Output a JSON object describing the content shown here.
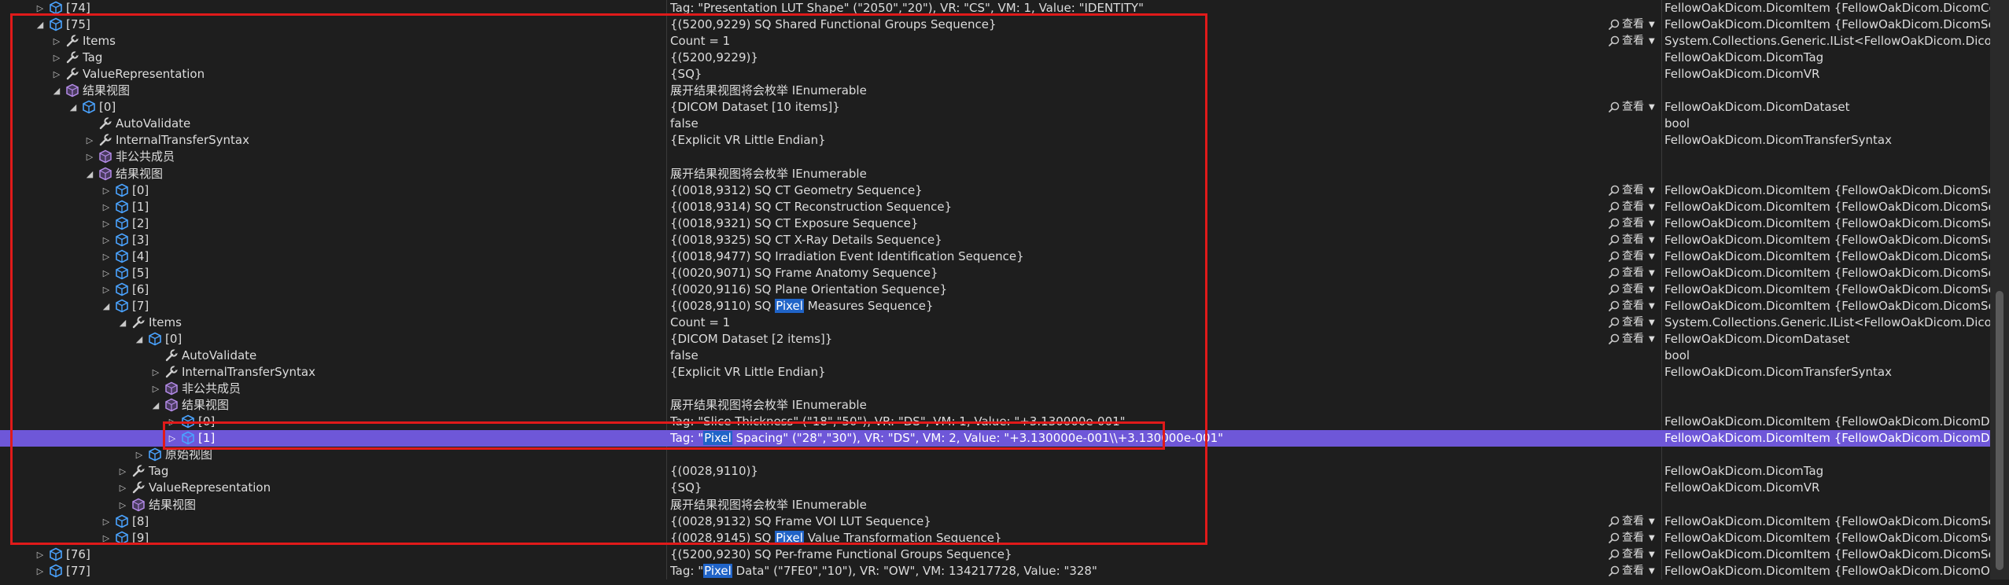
{
  "viewer_label": "查看",
  "colors": {
    "background": "#1e1e1e",
    "selected_row": "#6e57d8",
    "search_highlight": "#2064c8",
    "annotation_red": "#e01a1a",
    "cube_icon": "#4aa3ff",
    "struct_icon": "#9b6fd6"
  },
  "rows": [
    {
      "name": "[74]",
      "value": "Tag: \"Presentation LUT Shape\" (\"2050\",\"20\"), VR: \"CS\", VM: 1, Value: \"IDENTITY\"",
      "type": "FellowOakDicom.DicomItem {FellowOakDicom.DicomCodeSt…",
      "icon": "cube-icon"
    },
    {
      "name": "[75]",
      "value": "{(5200,9229) SQ Shared Functional Groups Sequence}",
      "type": "FellowOakDicom.DicomItem {FellowOakDicom.DicomSeque…",
      "icon": "cube-icon"
    },
    {
      "name": "Items",
      "value": "Count = 1",
      "type": "System.Collections.Generic.IList<FellowOakDicom.DicomData…",
      "icon": "wrench-icon"
    },
    {
      "name": "Tag",
      "value": "{(5200,9229)}",
      "type": "FellowOakDicom.DicomTag",
      "icon": "wrench-icon"
    },
    {
      "name": "ValueRepresentation",
      "value": "{SQ}",
      "type": "FellowOakDicom.DicomVR",
      "icon": "wrench-icon"
    },
    {
      "name": "结果视图",
      "value": "展开结果视图将会枚举 IEnumerable",
      "type": "",
      "icon": "struct-icon"
    },
    {
      "name": "[0]",
      "value": "{DICOM Dataset [10 items]}",
      "type": "FellowOakDicom.DicomDataset",
      "icon": "cube-icon"
    },
    {
      "name": "AutoValidate",
      "value": "false",
      "type": "bool",
      "icon": "wrench-icon"
    },
    {
      "name": "InternalTransferSyntax",
      "value": "{Explicit VR Little Endian}",
      "type": "FellowOakDicom.DicomTransferSyntax",
      "icon": "wrench-icon"
    },
    {
      "name": "非公共成员",
      "value": "",
      "type": "",
      "icon": "struct-icon"
    },
    {
      "name": "结果视图",
      "value": "展开结果视图将会枚举 IEnumerable",
      "type": "",
      "icon": "struct-icon"
    },
    {
      "name": "[0]",
      "value": "{(0018,9312) SQ CT Geometry Sequence}",
      "type": "FellowOakDicom.DicomItem {FellowOakDicom.DicomSeque…",
      "icon": "cube-icon"
    },
    {
      "name": "[1]",
      "value": "{(0018,9314) SQ CT Reconstruction Sequence}",
      "type": "FellowOakDicom.DicomItem {FellowOakDicom.DicomSeque…",
      "icon": "cube-icon"
    },
    {
      "name": "[2]",
      "value": "{(0018,9321) SQ CT Exposure Sequence}",
      "type": "FellowOakDicom.DicomItem {FellowOakDicom.DicomSeque…",
      "icon": "cube-icon"
    },
    {
      "name": "[3]",
      "value": "{(0018,9325) SQ CT X-Ray Details Sequence}",
      "type": "FellowOakDicom.DicomItem {FellowOakDicom.DicomSeque…",
      "icon": "cube-icon"
    },
    {
      "name": "[4]",
      "value": "{(0018,9477) SQ Irradiation Event Identification Sequence}",
      "type": "FellowOakDicom.DicomItem {FellowOakDicom.DicomSeque…",
      "icon": "cube-icon"
    },
    {
      "name": "[5]",
      "value": "{(0020,9071) SQ Frame Anatomy Sequence}",
      "type": "FellowOakDicom.DicomItem {FellowOakDicom.DicomSeque…",
      "icon": "cube-icon"
    },
    {
      "name": "[6]",
      "value": "{(0020,9116) SQ Plane Orientation Sequence}",
      "type": "FellowOakDicom.DicomItem {FellowOakDicom.DicomSeque…",
      "icon": "cube-icon"
    },
    {
      "name": "[7]",
      "value_pre": "{(0028,9110) SQ ",
      "value_hl": "Pixel",
      "value_post": " Measures Sequence}",
      "type": "FellowOakDicom.DicomItem {FellowOakDicom.DicomSeque…",
      "icon": "cube-icon"
    },
    {
      "name": "Items",
      "value": "Count = 1",
      "type": "System.Collections.Generic.IList<FellowOakDicom.DicomData…",
      "icon": "wrench-icon"
    },
    {
      "name": "[0]",
      "value": "{DICOM Dataset [2 items]}",
      "type": "FellowOakDicom.DicomDataset",
      "icon": "cube-icon"
    },
    {
      "name": "AutoValidate",
      "value": "false",
      "type": "bool",
      "icon": "wrench-icon"
    },
    {
      "name": "InternalTransferSyntax",
      "value": "{Explicit VR Little Endian}",
      "type": "FellowOakDicom.DicomTransferSyntax",
      "icon": "wrench-icon"
    },
    {
      "name": "非公共成员",
      "value": "",
      "type": "",
      "icon": "struct-icon"
    },
    {
      "name": "结果视图",
      "value": "展开结果视图将会枚举 IEnumerable",
      "type": "",
      "icon": "struct-icon"
    },
    {
      "name": "[0]",
      "value": "Tag: \"Slice Thickness\" (\"18\",\"50\"), VR: \"DS\", VM: 1, Value: \"+3.130000e-001\"",
      "type": "FellowOakDicom.DicomItem {FellowOakDicom.DicomDecim…",
      "icon": "cube-icon"
    },
    {
      "name": "[1]",
      "value_pre": "Tag: \"",
      "value_hl": "Pixel",
      "value_post": " Spacing\" (\"28\",\"30\"), VR: \"DS\", VM: 2, Value: \"+3.130000e-001\\\\+3.130000e-001\"",
      "type": "FellowOakDicom.DicomItem {FellowOakDicom.DicomDecim…",
      "icon": "cube-icon"
    },
    {
      "name": "原始视图",
      "value": "",
      "type": "",
      "icon": "cube-icon"
    },
    {
      "name": "Tag",
      "value": "{(0028,9110)}",
      "type": "FellowOakDicom.DicomTag",
      "icon": "wrench-icon"
    },
    {
      "name": "ValueRepresentation",
      "value": "{SQ}",
      "type": "FellowOakDicom.DicomVR",
      "icon": "wrench-icon"
    },
    {
      "name": "结果视图",
      "value": "展开结果视图将会枚举 IEnumerable",
      "type": "",
      "icon": "struct-icon"
    },
    {
      "name": "[8]",
      "value": "{(0028,9132) SQ Frame VOI LUT Sequence}",
      "type": "FellowOakDicom.DicomItem {FellowOakDicom.DicomSeque…",
      "icon": "cube-icon"
    },
    {
      "name": "[9]",
      "value_pre": "{(0028,9145) SQ ",
      "value_hl": "Pixel",
      "value_post": " Value Transformation Sequence}",
      "type": "FellowOakDicom.DicomItem {FellowOakDicom.DicomSeque…",
      "icon": "cube-icon"
    },
    {
      "name": "[76]",
      "value": "{(5200,9230) SQ Per-frame Functional Groups Sequence}",
      "type": "FellowOakDicom.DicomItem {FellowOakDicom.DicomSeque…",
      "icon": "cube-icon"
    },
    {
      "name": "[77]",
      "value_pre": "Tag: \"",
      "value_hl": "Pixel",
      "value_post": " Data\" (\"7FE0\",\"10\"), VR: \"OW\", VM: 134217728, Value: \"328\"",
      "type": "FellowOakDicom.DicomItem {FellowOakDicom.DicomOther…",
      "icon": "cube-icon"
    }
  ]
}
